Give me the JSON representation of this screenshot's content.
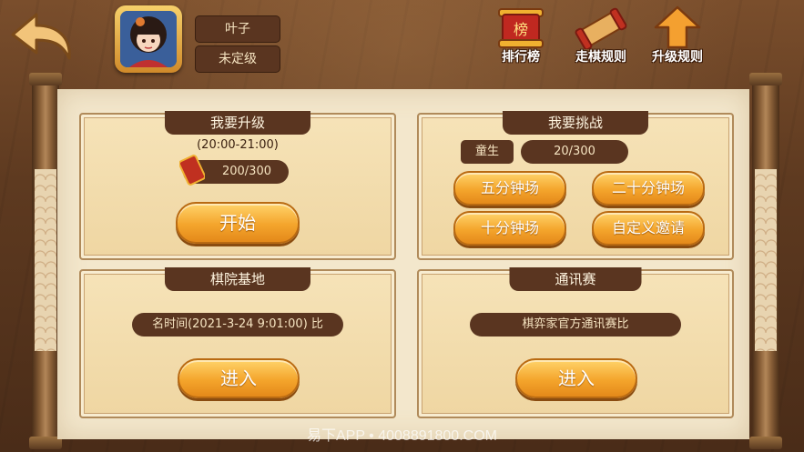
{
  "header": {
    "player_name": "叶子",
    "player_rank": "未定级",
    "actions": [
      {
        "label": "排行榜",
        "icon": "leaderboard-icon"
      },
      {
        "label": "走棋规则",
        "icon": "rules-scroll-icon"
      },
      {
        "label": "升级规则",
        "icon": "upgrade-arrow-icon"
      }
    ]
  },
  "upgrade": {
    "title": "我要升级",
    "time_range": "(20:00-21:00)",
    "progress": "200/300",
    "start_label": "开始"
  },
  "challenge": {
    "title": "我要挑战",
    "rank_badge": "童生",
    "progress": "20/300",
    "buttons": [
      "五分钟场",
      "二十分钟场",
      "十分钟场",
      "自定义邀请"
    ]
  },
  "academy": {
    "title": "棋院基地",
    "info": "名时间(2021-3-24 9:01:00) 比",
    "enter_label": "进入"
  },
  "correspondence": {
    "title": "通讯赛",
    "info": "棋弈家官方通讯赛比",
    "enter_label": "进入"
  },
  "watermark": "易下APP • 4008891800.COM",
  "colors": {
    "accent": "#f4a52c",
    "panel_header": "#5a3520",
    "paper": "#f3e7cc"
  }
}
